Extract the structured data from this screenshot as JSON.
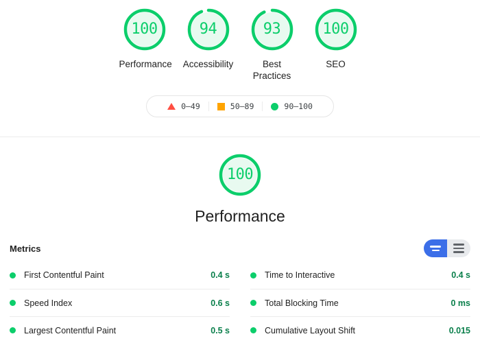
{
  "theme": {
    "pass_color": "#0cce6b",
    "average_color": "#ffa400",
    "fail_color": "#ff4e42",
    "pass_fill": "#e8faf0",
    "value_color": "#0a7f4b",
    "toggle_active_color": "#3b6ee8",
    "toggle_inactive_color": "#e8eaed"
  },
  "summary": {
    "gauges": [
      {
        "score": "100",
        "label": "Performance",
        "value": 100,
        "status": "pass"
      },
      {
        "score": "94",
        "label": "Accessibility",
        "value": 94,
        "status": "pass"
      },
      {
        "score": "93",
        "label": "Best Practices",
        "value": 93,
        "status": "pass"
      },
      {
        "score": "100",
        "label": "SEO",
        "value": 100,
        "status": "pass"
      }
    ]
  },
  "legend": {
    "items": [
      {
        "icon": "triangle-icon",
        "range": "0–49"
      },
      {
        "icon": "square-icon",
        "range": "50–89"
      },
      {
        "icon": "circle-icon",
        "range": "90–100"
      }
    ]
  },
  "category": {
    "score": "100",
    "value": 100,
    "title": "Performance"
  },
  "metrics": {
    "title": "Metrics",
    "toggle": {
      "active_option": "simple-view",
      "options": [
        "simple-view",
        "detail-view"
      ]
    },
    "left_column": [
      {
        "name": "First Contentful Paint",
        "value": "0.4 s",
        "status": "pass"
      },
      {
        "name": "Speed Index",
        "value": "0.6 s",
        "status": "pass"
      },
      {
        "name": "Largest Contentful Paint",
        "value": "0.5 s",
        "status": "pass"
      }
    ],
    "right_column": [
      {
        "name": "Time to Interactive",
        "value": "0.4 s",
        "status": "pass"
      },
      {
        "name": "Total Blocking Time",
        "value": "0 ms",
        "status": "pass"
      },
      {
        "name": "Cumulative Layout Shift",
        "value": "0.015",
        "status": "pass"
      }
    ]
  }
}
